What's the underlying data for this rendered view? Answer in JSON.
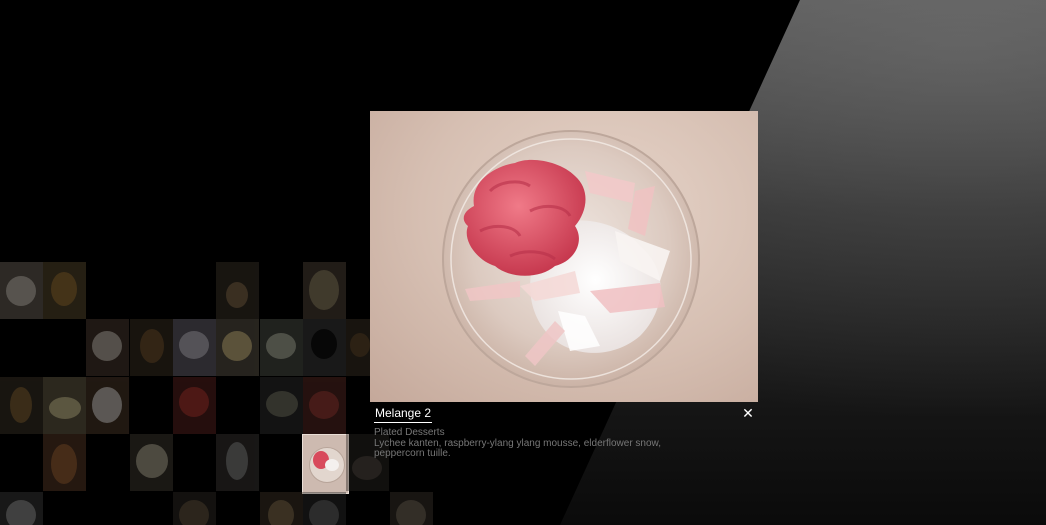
{
  "lightbox": {
    "title": "Melange 2",
    "category": "Plated Desserts",
    "description": "Lychee kanten, raspberry-ylang ylang mousse, elderflower snow, peppercorn tuille.",
    "close_label": "✕"
  },
  "colors": {
    "background": "#000000",
    "caption_text": "#777777",
    "title_text": "#ffffff",
    "photo_backdrop": "#d8c3b7",
    "mousse": "#e0586a"
  },
  "icons": {
    "close": "close-icon"
  }
}
